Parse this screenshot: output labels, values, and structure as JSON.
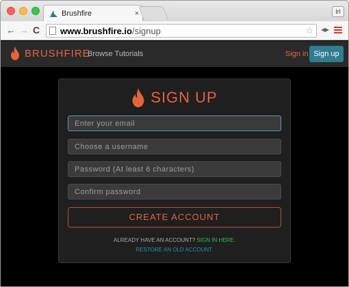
{
  "browser": {
    "tab_title": "Brushfire",
    "tab_close": "×",
    "profile": "Irl",
    "url_host": "www.brushfire.io",
    "url_path": "/signup"
  },
  "site": {
    "logo_text": "BRUSHFIRE",
    "nav_browse": "Browse Tutorials",
    "signin_label": "Sign in",
    "signup_label": "Sign up",
    "brand_color": "#e5643c",
    "accent_color": "#2f7d8e"
  },
  "form": {
    "title": "SIGN UP",
    "email_placeholder": "Enter your email",
    "username_placeholder": "Choose a username",
    "password_placeholder": "Password (At least 6 characters)",
    "confirm_placeholder": "Confirm password",
    "create_label": "CREATE ACCOUNT",
    "already_text": "ALREADY HAVE AN ACCOUNT?",
    "signin_here": "SIGN IN HERE.",
    "restore_text": "RESTORE AN OLD ACCOUNT."
  }
}
